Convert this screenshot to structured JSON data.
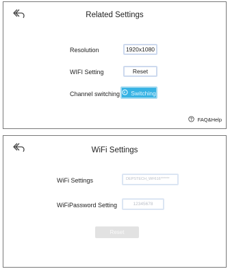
{
  "related_settings": {
    "title": "Related Settings",
    "resolution": {
      "label": "Resolution",
      "value": "1920x1080"
    },
    "wifi_setting": {
      "label": "WIFI Setting",
      "button": "Reset"
    },
    "channel_switching": {
      "label": "Channel switching",
      "button": "Switching",
      "color": "#37b3e4"
    },
    "faq": "FAQ&Help"
  },
  "wifi_settings": {
    "title": "WiFi Settings",
    "ssid": {
      "label": "WiFi Settings",
      "placeholder": "DEPSTECH_WF616******"
    },
    "password": {
      "label": "WiFiPassword Setting",
      "placeholder": "12345678"
    },
    "reset_button": "Reset"
  }
}
